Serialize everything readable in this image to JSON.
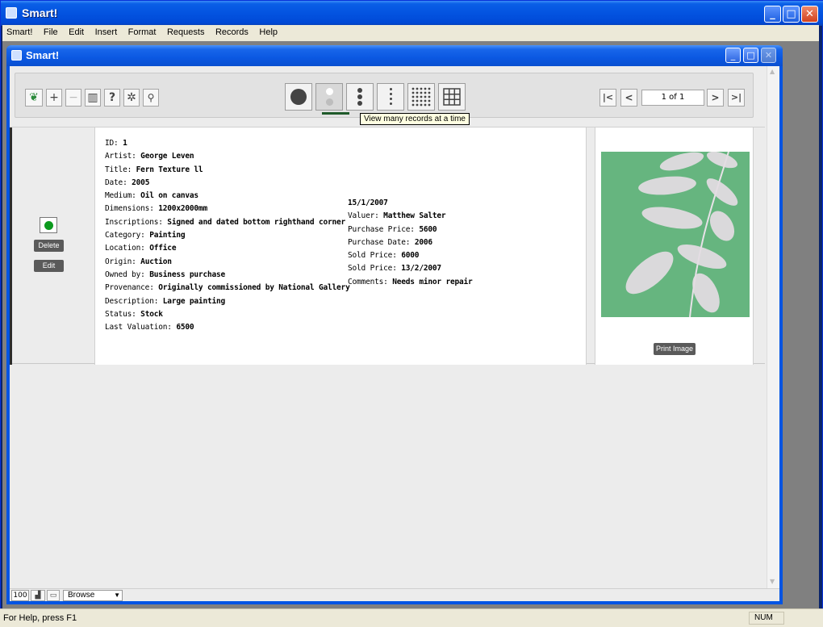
{
  "window": {
    "title": "Smart!",
    "minimize_glyph": "_",
    "maximize_glyph": "□",
    "close_glyph": "✕"
  },
  "menu": [
    "Smart!",
    "File",
    "Edit",
    "Insert",
    "Format",
    "Requests",
    "Records",
    "Help"
  ],
  "inner_window": {
    "title": "Smart!"
  },
  "toolbar": {
    "left_buttons": [
      {
        "icon": "leaf-icon",
        "glyph": "❦"
      },
      {
        "icon": "plus-icon",
        "glyph": "+"
      },
      {
        "icon": "minus-icon",
        "glyph": "−"
      },
      {
        "icon": "bar-chart-icon",
        "glyph": "▥"
      },
      {
        "icon": "help-icon",
        "glyph": "?"
      },
      {
        "icon": "gear-icon",
        "glyph": "✲"
      },
      {
        "icon": "search-icon",
        "glyph": "⚲"
      }
    ],
    "view_modes": [
      "single-record",
      "two-records",
      "three-records",
      "many-records-list",
      "grid-dots",
      "table"
    ],
    "selected_view_mode": "two-records",
    "nav": {
      "first": "|<",
      "prev": "<",
      "page": "1 of 1",
      "next": ">",
      "last": ">|"
    },
    "tooltip": "View many records at a time"
  },
  "record": {
    "delete_label": "Delete",
    "edit_label": "Edit",
    "fields_left": [
      {
        "label": "ID:",
        "value": "1"
      },
      {
        "label": "Artist:",
        "value": "George Leven"
      },
      {
        "label": "Title:",
        "value": "Fern Texture ll"
      },
      {
        "label": "Date:",
        "value": "2005"
      },
      {
        "label": "Medium:",
        "value": "Oil on canvas"
      },
      {
        "label": "Dimensions:",
        "value": "1200x2000mm"
      },
      {
        "label": "Inscriptions:",
        "value": "Signed and dated bottom righthand corner"
      },
      {
        "label": "Category:",
        "value": "Painting"
      },
      {
        "label": "Location:",
        "value": "Office"
      },
      {
        "label": "Origin:",
        "value": "Auction"
      },
      {
        "label": "Owned by:",
        "value": "Business purchase"
      },
      {
        "label": "Provenance:",
        "value": "Originally commissioned by National Gallery"
      },
      {
        "label": "Description:",
        "value": "Large painting"
      },
      {
        "label": "Status:",
        "value": "Stock"
      },
      {
        "label": "Last Valuation:",
        "value": "6500"
      }
    ],
    "fields_right": [
      {
        "label": "",
        "value": "15/1/2007"
      },
      {
        "label": "Valuer:",
        "value": "Matthew Salter"
      },
      {
        "label": "Purchase Price:",
        "value": "5600"
      },
      {
        "label": "Purchase Date:",
        "value": "2006"
      },
      {
        "label": "Sold Price:",
        "value": "6000"
      },
      {
        "label": "Sold Price:",
        "value": "13/2/2007"
      },
      {
        "label": "Comments:",
        "value": "Needs minor repair"
      }
    ],
    "print_image_label": "Print Image"
  },
  "bottom": {
    "zoom": "100",
    "mode": "Browse"
  },
  "status": {
    "help": "For Help, press F1",
    "num": "NUM"
  },
  "colors": {
    "titlebar": "#0353e0",
    "select_dot": "#0c9a1e",
    "art_bg": "#5fb07a"
  }
}
